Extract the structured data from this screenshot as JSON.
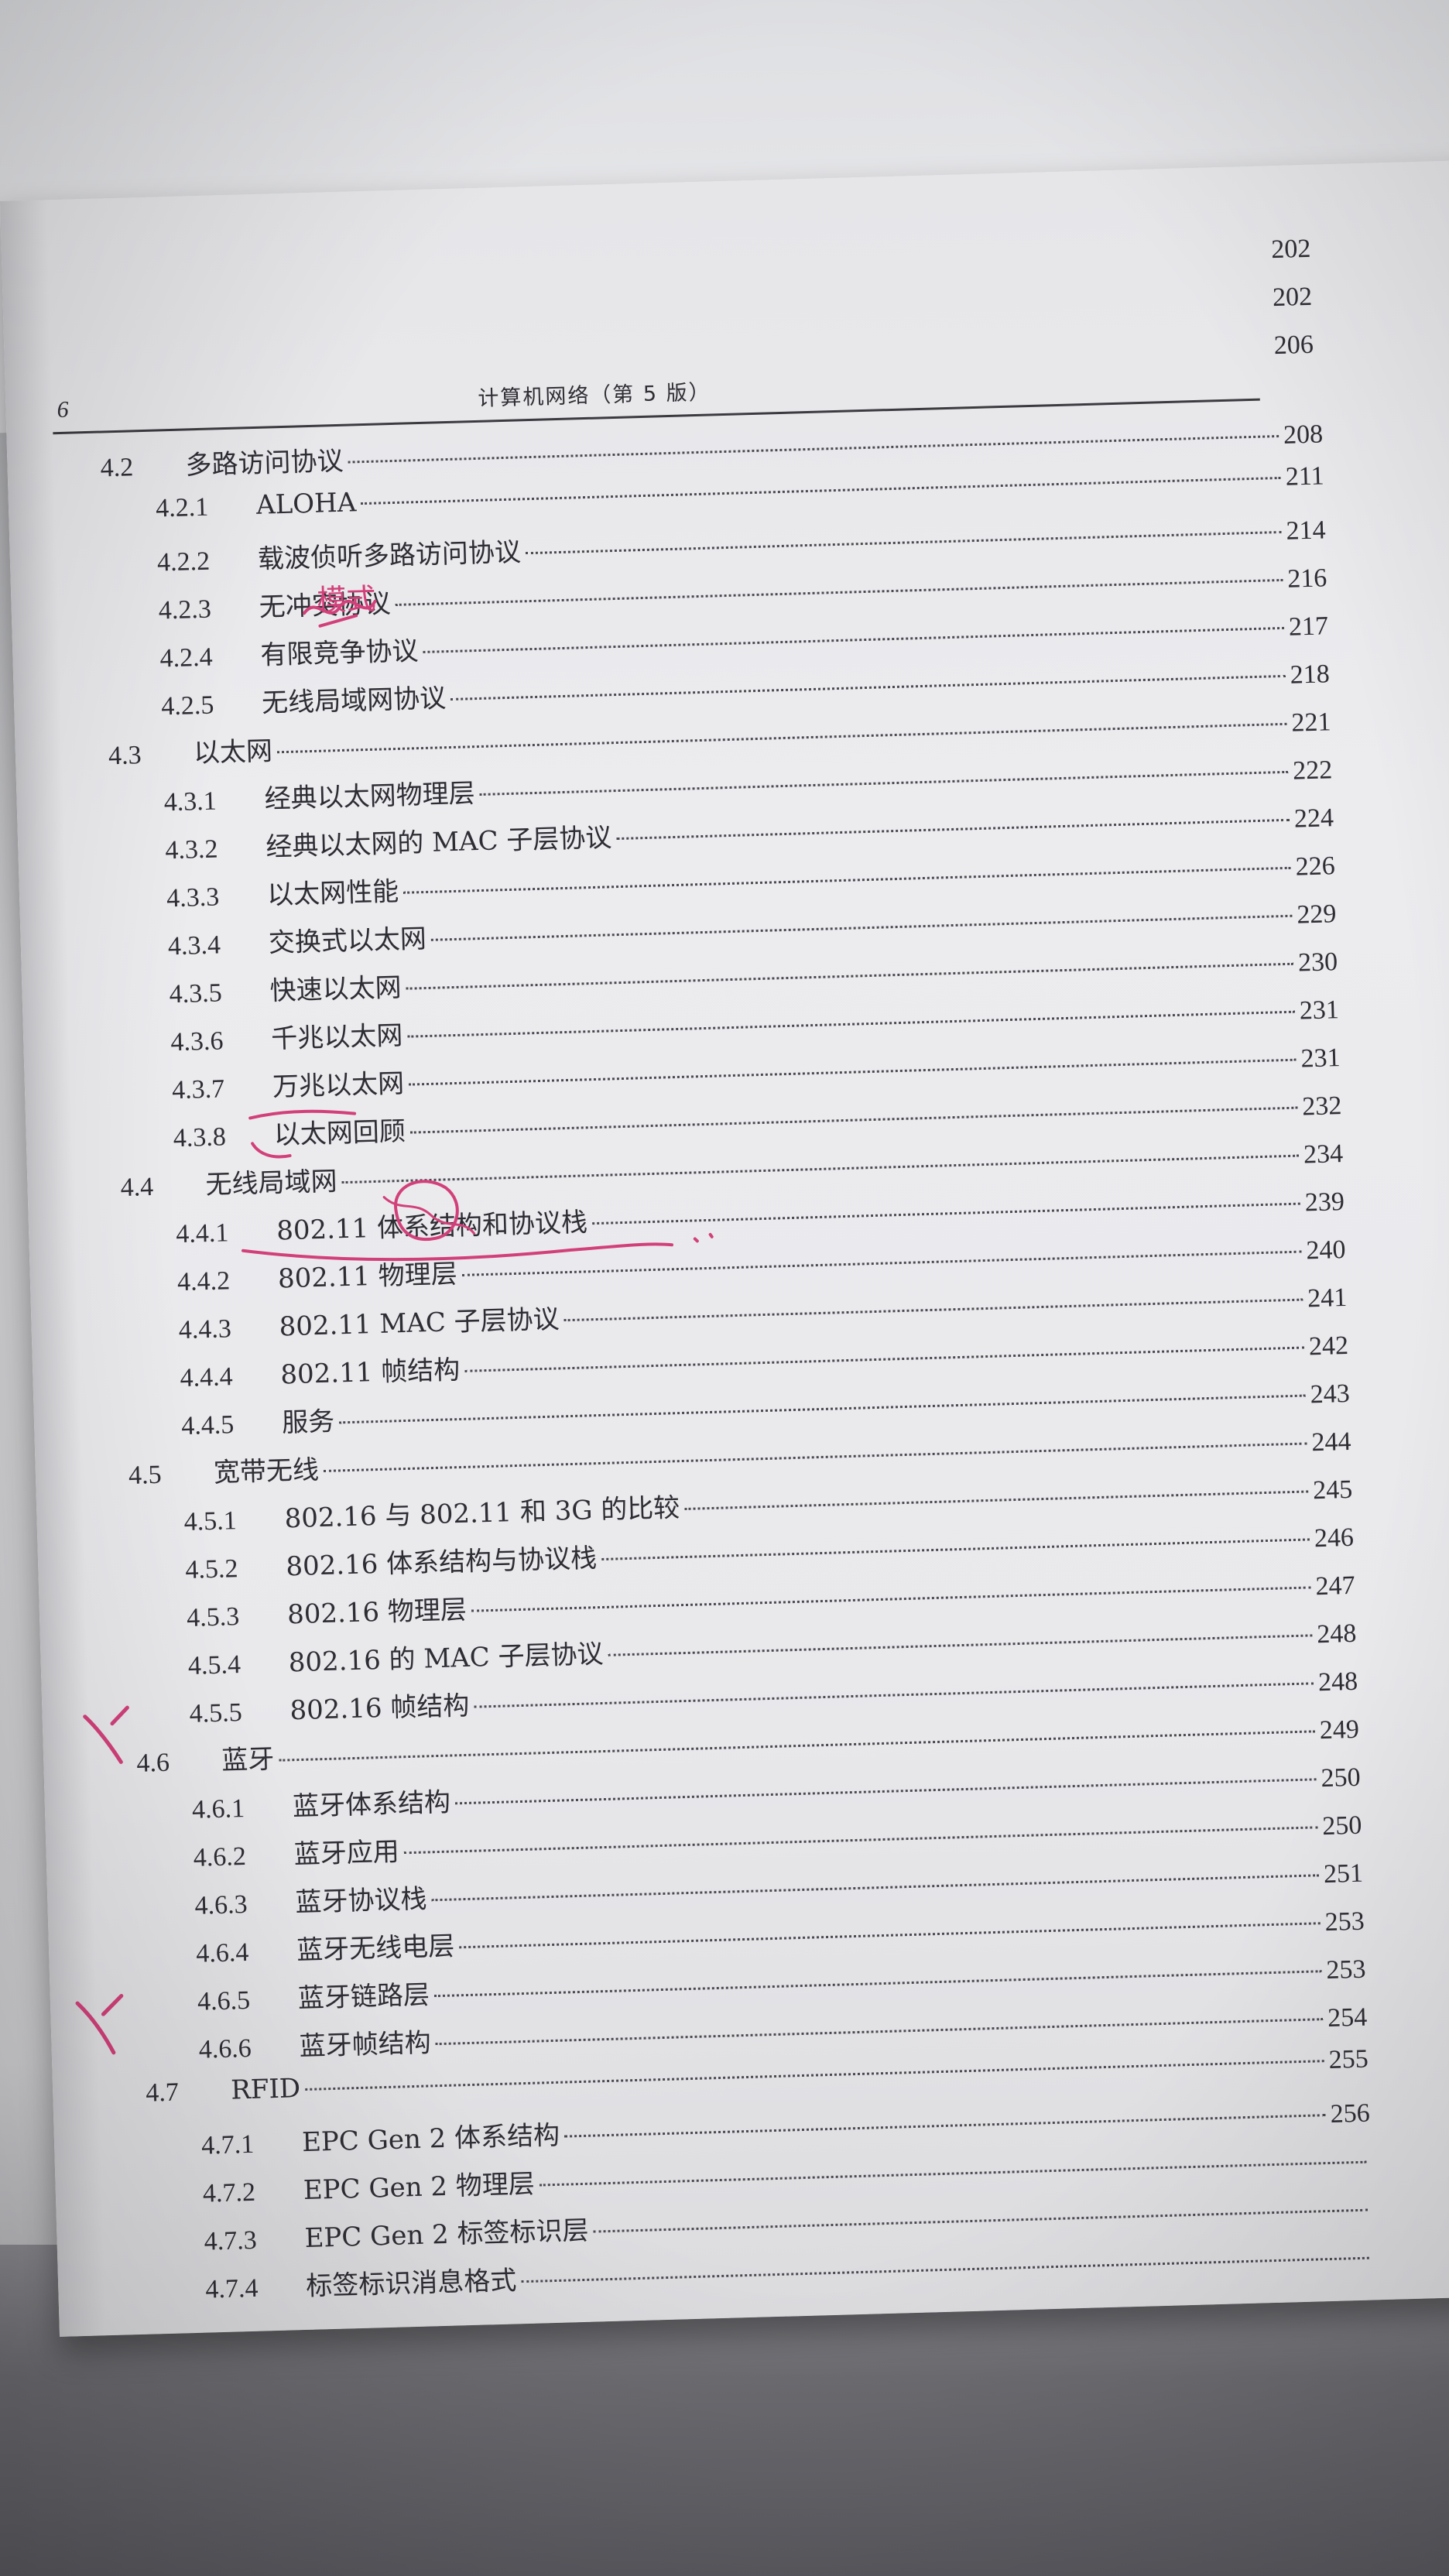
{
  "page_header": {
    "page_number": "6",
    "running_title": "计算机网络（第 5 版）"
  },
  "carryover_pages": [
    "202",
    "202",
    "206"
  ],
  "toc": [
    {
      "num": "4.2",
      "title": "多路访问协议",
      "page": "208",
      "level": 1
    },
    {
      "num": "4.2.1",
      "title": "ALOHA",
      "page": "211",
      "level": 2
    },
    {
      "num": "4.2.2",
      "title": "载波侦听多路访问协议",
      "page": "214",
      "level": 2
    },
    {
      "num": "4.2.3",
      "title": "无冲突协议",
      "page": "216",
      "level": 2
    },
    {
      "num": "4.2.4",
      "title": "有限竞争协议",
      "page": "217",
      "level": 2
    },
    {
      "num": "4.2.5",
      "title": "无线局域网协议",
      "page": "218",
      "level": 2
    },
    {
      "num": "4.3",
      "title": "以太网",
      "page": "221",
      "level": 1
    },
    {
      "num": "4.3.1",
      "title": "经典以太网物理层",
      "page": "222",
      "level": 2
    },
    {
      "num": "4.3.2",
      "title": "经典以太网的 MAC 子层协议",
      "page": "224",
      "level": 2
    },
    {
      "num": "4.3.3",
      "title": "以太网性能",
      "page": "226",
      "level": 2
    },
    {
      "num": "4.3.4",
      "title": "交换式以太网",
      "page": "229",
      "level": 2
    },
    {
      "num": "4.3.5",
      "title": "快速以太网",
      "page": "230",
      "level": 2
    },
    {
      "num": "4.3.6",
      "title": "千兆以太网",
      "page": "231",
      "level": 2
    },
    {
      "num": "4.3.7",
      "title": "万兆以太网",
      "page": "231",
      "level": 2
    },
    {
      "num": "4.3.8",
      "title": "以太网回顾",
      "page": "232",
      "level": 2
    },
    {
      "num": "4.4",
      "title": "无线局域网",
      "page": "234",
      "level": 1
    },
    {
      "num": "4.4.1",
      "title": "802.11 体系结构和协议栈",
      "page": "239",
      "level": 2
    },
    {
      "num": "4.4.2",
      "title": "802.11 物理层",
      "page": "240",
      "level": 2
    },
    {
      "num": "4.4.3",
      "title": "802.11 MAC 子层协议",
      "page": "241",
      "level": 2
    },
    {
      "num": "4.4.4",
      "title": "802.11 帧结构",
      "page": "242",
      "level": 2
    },
    {
      "num": "4.4.5",
      "title": "服务",
      "page": "243",
      "level": 2
    },
    {
      "num": "4.5",
      "title": "宽带无线",
      "page": "244",
      "level": 1
    },
    {
      "num": "4.5.1",
      "title": "802.16 与 802.11 和 3G 的比较",
      "page": "245",
      "level": 2
    },
    {
      "num": "4.5.2",
      "title": "802.16 体系结构与协议栈",
      "page": "246",
      "level": 2
    },
    {
      "num": "4.5.3",
      "title": "802.16 物理层",
      "page": "247",
      "level": 2
    },
    {
      "num": "4.5.4",
      "title": "802.16 的 MAC 子层协议",
      "page": "248",
      "level": 2
    },
    {
      "num": "4.5.5",
      "title": "802.16 帧结构",
      "page": "248",
      "level": 2
    },
    {
      "num": "4.6",
      "title": "蓝牙",
      "page": "249",
      "level": 1
    },
    {
      "num": "4.6.1",
      "title": "蓝牙体系结构",
      "page": "250",
      "level": 2
    },
    {
      "num": "4.6.2",
      "title": "蓝牙应用",
      "page": "250",
      "level": 2
    },
    {
      "num": "4.6.3",
      "title": "蓝牙协议栈",
      "page": "251",
      "level": 2
    },
    {
      "num": "4.6.4",
      "title": "蓝牙无线电层",
      "page": "253",
      "level": 2
    },
    {
      "num": "4.6.5",
      "title": "蓝牙链路层",
      "page": "253",
      "level": 2
    },
    {
      "num": "4.6.6",
      "title": "蓝牙帧结构",
      "page": "254",
      "level": 2
    },
    {
      "num": "4.7",
      "title": "RFID",
      "page": "255",
      "level": 1
    },
    {
      "num": "4.7.1",
      "title": "EPC Gen 2 体系结构",
      "page": "256",
      "level": 2
    },
    {
      "num": "4.7.2",
      "title": "EPC Gen 2 物理层",
      "page": "",
      "level": 2
    },
    {
      "num": "4.7.3",
      "title": "EPC Gen 2 标签标识层",
      "page": "",
      "level": 2
    },
    {
      "num": "4.7.4",
      "title": "标签标识消息格式",
      "page": "",
      "level": 2
    }
  ],
  "annotations": {
    "handwritten_note": "模式",
    "ink_color": "#d2407a"
  }
}
